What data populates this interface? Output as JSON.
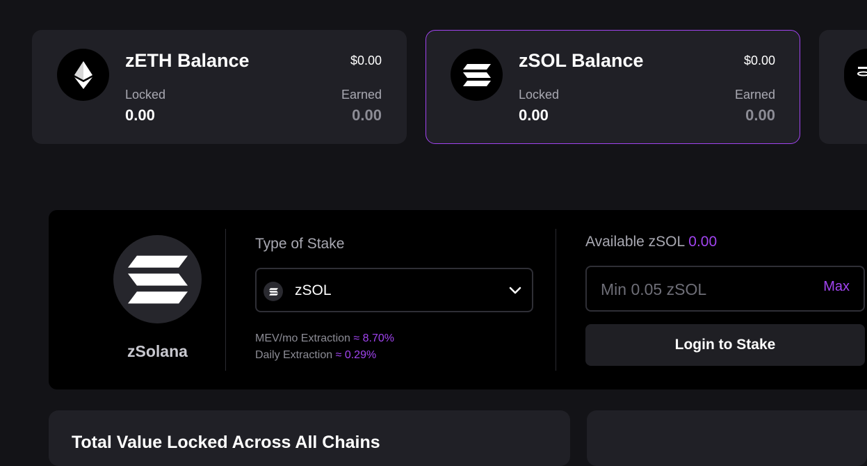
{
  "balances": [
    {
      "title": "zETH Balance",
      "usd": "$0.00",
      "locked_label": "Locked",
      "locked": "0.00",
      "earned_label": "Earned",
      "earned": "0.00",
      "icon": "ethereum-icon"
    },
    {
      "title": "zSOL Balance",
      "usd": "$0.00",
      "locked_label": "Locked",
      "locked": "0.00",
      "earned_label": "Earned",
      "earned": "0.00",
      "icon": "solana-icon"
    }
  ],
  "stake": {
    "coin_name": "zSolana",
    "type_label": "Type of Stake",
    "selected": "zSOL",
    "mev_label": "MEV/mo Extraction",
    "mev_value": "≈ 8.70%",
    "daily_label": "Daily Extraction",
    "daily_value": "≈ 0.29%",
    "available_label": "Available zSOL",
    "available_value": "0.00",
    "amount_placeholder": "Min 0.05 zSOL",
    "max_label": "Max",
    "login_label": "Login to Stake"
  },
  "tvl": {
    "title": "Total Value Locked Across All Chains"
  },
  "colors": {
    "accent": "#a144f0",
    "background": "#131317",
    "card": "#202026"
  }
}
